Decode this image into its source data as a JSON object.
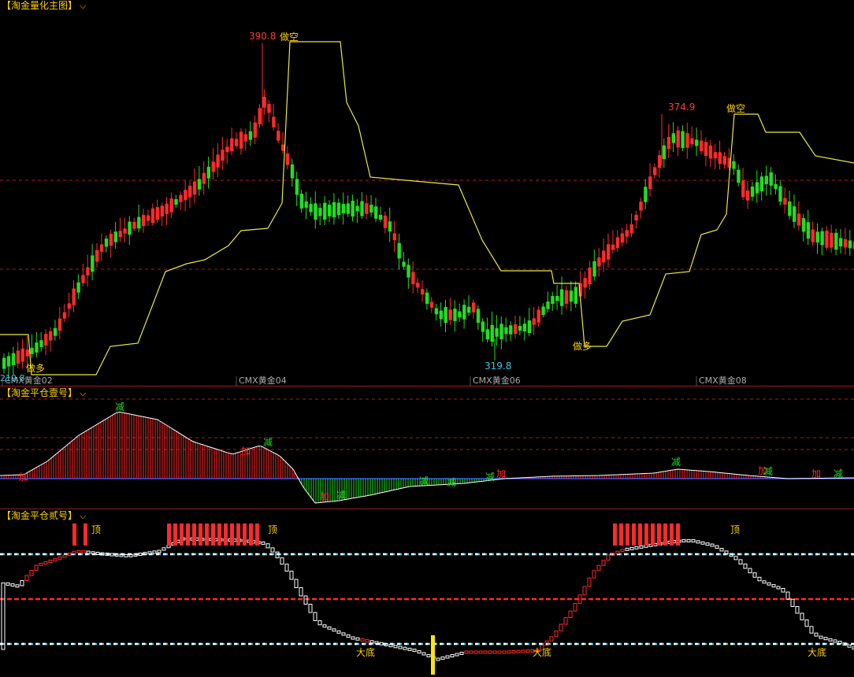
{
  "panels": {
    "main": {
      "title": "【淘金量化主图】",
      "high1": "390.8",
      "high2": "374.9",
      "low": "319.8",
      "start_label": "219.8",
      "signals": {
        "short": "做空",
        "long": "做多"
      },
      "xaxis": [
        "CMX黄金02",
        "CMX黄金04",
        "CMX黄金06",
        "CMX黄金08"
      ]
    },
    "ind1": {
      "title": "【淘金平仓壹号】",
      "signals": {
        "reduce": "减",
        "add": "加"
      }
    },
    "ind2": {
      "title": "【淘金平仓贰号】",
      "signals": {
        "top": "顶",
        "bottom": "大底"
      }
    }
  },
  "colors": {
    "up": "#ff2a2a",
    "down": "#22dd22",
    "stop_line": "#e8e84a",
    "grid_dash": "#b01c1c",
    "cyan": "#3ad6e8",
    "white": "#ffffff",
    "label_gold": "#ffd200",
    "label_red": "#ff3b3b",
    "label_cyan": "#38c8e8"
  },
  "chart_data": [
    {
      "type": "candlestick",
      "title": "【淘金量化主图】",
      "x_categories": [
        "CMX黄金02",
        "CMX黄金04",
        "CMX黄金06",
        "CMX黄金08"
      ],
      "annotations": [
        {
          "text": "390.8",
          "kind": "high"
        },
        {
          "text": "374.9",
          "kind": "high"
        },
        {
          "text": "319.8",
          "kind": "low"
        },
        {
          "text": "219.8",
          "kind": "start"
        },
        {
          "text": "做空",
          "kind": "signal"
        },
        {
          "text": "做空",
          "kind": "signal"
        },
        {
          "text": "做多",
          "kind": "signal"
        },
        {
          "text": "做多",
          "kind": "signal"
        }
      ],
      "series": [
        {
          "name": "close",
          "values": [
            250,
            262,
            275,
            292,
            306,
            318,
            328,
            334,
            341,
            346,
            352,
            355,
            360,
            366,
            371,
            378,
            384,
            388,
            375,
            358,
            348,
            352,
            350,
            355,
            352,
            347,
            345,
            342,
            337,
            330,
            322,
            320,
            321,
            325,
            330,
            333,
            339,
            346,
            352,
            360,
            368,
            372,
            368,
            364,
            358,
            355,
            351,
            348
          ]
        }
      ],
      "grid": true
    },
    {
      "type": "bar",
      "title": "【淘金平仓壹号】",
      "series": [
        {
          "values": [
            0,
            4,
            18,
            40,
            62,
            72,
            74,
            70,
            64,
            58,
            50,
            40,
            30,
            24,
            20,
            16,
            12,
            -4,
            -16,
            -22,
            -20,
            -16,
            -12,
            -8,
            -5,
            -3,
            -1,
            0,
            1,
            2,
            3,
            4,
            5,
            6,
            7,
            6,
            4,
            3,
            2,
            1,
            0
          ]
        }
      ],
      "annotations": [
        "减",
        "加"
      ]
    },
    {
      "type": "step-line",
      "title": "【淘金平仓贰号】",
      "series": [
        {
          "values": [
            40,
            48,
            62,
            78,
            86,
            90,
            92,
            92,
            93,
            95,
            94,
            88,
            70,
            48,
            30,
            18,
            10,
            6,
            4,
            3,
            2,
            3,
            5,
            6,
            8,
            14,
            30,
            52,
            74,
            90,
            94,
            96,
            96,
            92,
            86,
            76,
            62,
            46,
            30,
            16,
            8,
            4
          ]
        }
      ],
      "reference_levels": [
        80,
        50,
        10
      ],
      "annotations": [
        "顶",
        "大底"
      ]
    }
  ]
}
